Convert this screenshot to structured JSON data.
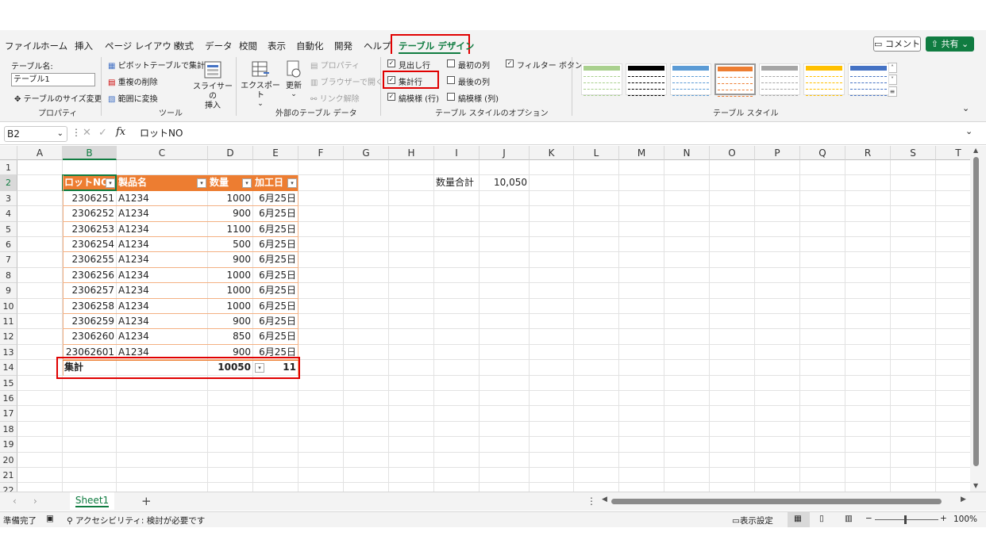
{
  "ribbon_tabs": [
    "ファイル",
    "ホーム",
    "挿入",
    "ページ レイアウト",
    "数式",
    "データ",
    "校閲",
    "表示",
    "自動化",
    "開発",
    "ヘルプ"
  ],
  "active_tab": "テーブル デザイン",
  "comment_button": "コメント",
  "share_button": "共有",
  "properties_group": {
    "table_name_label": "テーブル名:",
    "table_name_value": "テーブル1",
    "resize": "テーブルのサイズ変更",
    "group_label": "プロパティ"
  },
  "tools_group": {
    "pivot": "ピボットテーブルで集計",
    "remove_dup": "重複の削除",
    "convert": "範囲に変換",
    "slicer_line1": "スライサーの",
    "slicer_line2": "挿入",
    "group_label": "ツール"
  },
  "external_group": {
    "export": "エクスポート",
    "refresh": "更新",
    "properties": "プロパティ",
    "browser": "ブラウザーで開く",
    "unlink": "リンク解除",
    "group_label": "外部のテーブル データ"
  },
  "options_group": {
    "header_row": "見出し行",
    "total_row": "集計行",
    "banded_rows": "縞模様 (行)",
    "first_col": "最初の列",
    "last_col": "最後の列",
    "banded_cols": "縞模様 (列)",
    "filter_btn": "フィルター ボタン",
    "group_label": "テーブル スタイルのオプション"
  },
  "styles_group": {
    "group_label": "テーブル スタイル",
    "swatch_colors": [
      "#a9d08e",
      "#000000",
      "#5b9bd5",
      "#ed7d31",
      "#a5a5a5",
      "#ffc000",
      "#4472c4"
    ]
  },
  "formula_bar": {
    "name_box": "B2",
    "formula": "ロットNO"
  },
  "columns": [
    "A",
    "B",
    "C",
    "D",
    "E",
    "F",
    "G",
    "H",
    "I",
    "J",
    "K",
    "L",
    "M",
    "N",
    "O",
    "P",
    "Q",
    "R",
    "S",
    "T"
  ],
  "rows": [
    "1",
    "2",
    "3",
    "4",
    "5",
    "6",
    "7",
    "8",
    "9",
    "10",
    "11",
    "12",
    "13",
    "14",
    "15",
    "16",
    "17",
    "18",
    "19",
    "20",
    "21",
    "22"
  ],
  "table": {
    "headers": [
      "ロットNO",
      "製品名",
      "数量",
      "加工日"
    ],
    "rows": [
      [
        "2306251",
        "A1234",
        "1000",
        "6月25日"
      ],
      [
        "2306252",
        "A1234",
        "900",
        "6月25日"
      ],
      [
        "2306253",
        "A1234",
        "1100",
        "6月25日"
      ],
      [
        "2306254",
        "A1234",
        "500",
        "6月25日"
      ],
      [
        "2306255",
        "A1234",
        "900",
        "6月25日"
      ],
      [
        "2306256",
        "A1234",
        "1000",
        "6月25日"
      ],
      [
        "2306257",
        "A1234",
        "1000",
        "6月25日"
      ],
      [
        "2306258",
        "A1234",
        "1000",
        "6月25日"
      ],
      [
        "2306259",
        "A1234",
        "900",
        "6月25日"
      ],
      [
        "2306260",
        "A1234",
        "850",
        "6月25日"
      ],
      [
        "23062601",
        "A1234",
        "900",
        "6月25日"
      ]
    ],
    "total_label": "集計",
    "total_qty": "10050",
    "total_date": "11"
  },
  "side_cells": {
    "label": "数量合計",
    "value": "10,050"
  },
  "sheet_tab": "Sheet1",
  "status": {
    "ready": "準備完了",
    "accessibility": "アクセシビリティ: 検討が必要です",
    "display_settings": "表示設定",
    "zoom": "100%"
  }
}
